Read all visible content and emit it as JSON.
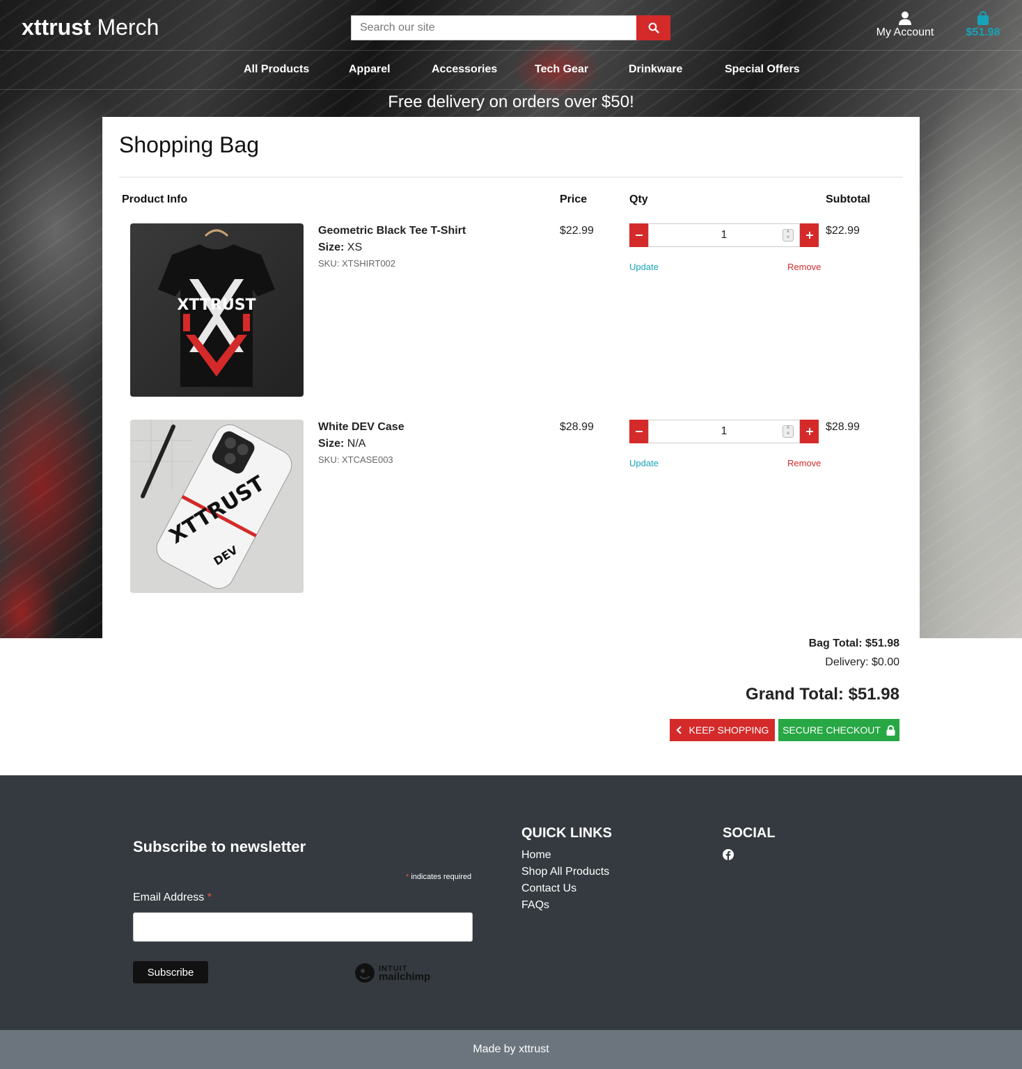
{
  "header": {
    "brand_bold": "xttrust",
    "brand_rest": "Merch",
    "search_placeholder": "Search our site",
    "account_label": "My Account",
    "bag_total": "$51.98"
  },
  "nav": {
    "items": [
      "All Products",
      "Apparel",
      "Accessories",
      "Tech Gear",
      "Drinkware",
      "Special Offers"
    ]
  },
  "banner": "Free delivery on orders over $50!",
  "bag": {
    "title": "Shopping Bag",
    "columns": {
      "product": "Product Info",
      "price": "Price",
      "qty": "Qty",
      "subtotal": "Subtotal"
    },
    "items": [
      {
        "name": "Geometric Black Tee T-Shirt",
        "size_label": "Size:",
        "size": "XS",
        "sku": "SKU: XTSHIRT002",
        "price": "$22.99",
        "qty": "1",
        "subtotal": "$22.99",
        "update": "Update",
        "remove": "Remove",
        "image_text": "XTTRUST"
      },
      {
        "name": "White DEV Case",
        "size_label": "Size:",
        "size": "N/A",
        "sku": "SKU: XTCASE003",
        "price": "$28.99",
        "qty": "1",
        "subtotal": "$28.99",
        "update": "Update",
        "remove": "Remove",
        "image_text": "XTTRUST",
        "image_sub": "DEV"
      }
    ]
  },
  "totals": {
    "bag_total": "Bag Total: $51.98",
    "delivery": "Delivery: $0.00",
    "grand_total": "Grand Total: $51.98",
    "keep_shopping": "KEEP SHOPPING",
    "secure_checkout": "SECURE CHECKOUT"
  },
  "footer": {
    "newsletter_title": "Subscribe to newsletter",
    "required_star": "*",
    "required_note": "indicates required",
    "email_label": "Email Address",
    "subscribe": "Subscribe",
    "mailchimp_top": "INTUIT",
    "mailchimp_bottom": "mailchimp",
    "quick_links_title": "QUICK LINKS",
    "quick_links": [
      "Home",
      "Shop All Products",
      "Contact Us",
      "FAQs"
    ],
    "social_title": "SOCIAL",
    "made_by": "Made by xttrust"
  },
  "colors": {
    "accent_red": "#d42a2a",
    "accent_teal": "#17a2b8",
    "checkout_green": "#28a745",
    "footer_bg": "#343a40",
    "bottom_bar": "#6c757d"
  }
}
